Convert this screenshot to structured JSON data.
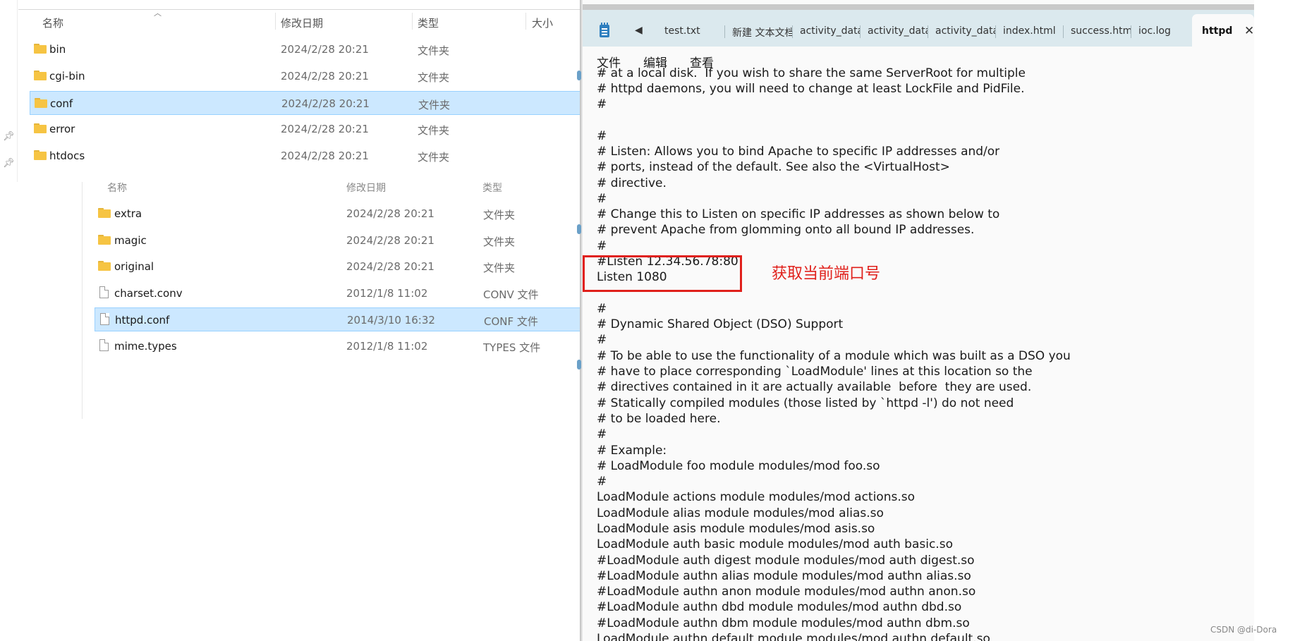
{
  "explorer_top": {
    "columns": {
      "name": "名称",
      "modified": "修改日期",
      "type": "类型",
      "size": "大小"
    },
    "rows": [
      {
        "name": "bin",
        "modified": "2024/2/28 20:21",
        "type": "文件夹",
        "icon": "folder-icon"
      },
      {
        "name": "cgi-bin",
        "modified": "2024/2/28 20:21",
        "type": "文件夹",
        "icon": "folder-icon"
      },
      {
        "name": "conf",
        "modified": "2024/2/28 20:21",
        "type": "文件夹",
        "icon": "folder-icon",
        "selected": true
      },
      {
        "name": "error",
        "modified": "2024/2/28 20:21",
        "type": "文件夹",
        "icon": "folder-icon"
      },
      {
        "name": "htdocs",
        "modified": "2024/2/28 20:21",
        "type": "文件夹",
        "icon": "folder-icon"
      }
    ]
  },
  "explorer_bottom": {
    "columns": {
      "name": "名称",
      "modified": "修改日期",
      "type": "类型"
    },
    "rows": [
      {
        "name": "extra",
        "modified": "2024/2/28 20:21",
        "type": "文件夹",
        "icon": "folder-icon"
      },
      {
        "name": "magic",
        "modified": "2024/2/28 20:21",
        "type": "文件夹",
        "icon": "folder-icon"
      },
      {
        "name": "original",
        "modified": "2024/2/28 20:21",
        "type": "文件夹",
        "icon": "folder-icon"
      },
      {
        "name": "charset.conv",
        "modified": "2012/1/8 11:02",
        "type": "CONV 文件",
        "icon": "file-icon"
      },
      {
        "name": "httpd.conf",
        "modified": "2014/3/10 16:32",
        "type": "CONF 文件",
        "icon": "file-icon",
        "selected": true
      },
      {
        "name": "mime.types",
        "modified": "2012/1/8 11:02",
        "type": "TYPES 文件",
        "icon": "file-icon"
      }
    ]
  },
  "notepad": {
    "tabs": [
      "test.txt",
      "新建 文本文档",
      "activity_data",
      "activity_data",
      "activity_data",
      "index.html",
      "success.htm",
      "ioc.log",
      "httpd"
    ],
    "active_tab": "httpd",
    "close_glyph": "✕",
    "back_glyph": "◀",
    "menu": {
      "file": "文件",
      "edit": "编辑",
      "view": "查看"
    },
    "lines": [
      "# at a local disk.  If you wish to share the same ServerRoot for multiple",
      "# httpd daemons, you will need to change at least LockFile and PidFile.",
      "#",
      "",
      "#",
      "# Listen: Allows you to bind Apache to specific IP addresses and/or",
      "# ports, instead of the default. See also the <VirtualHost>",
      "# directive.",
      "#",
      "# Change this to Listen on specific IP addresses as shown below to",
      "# prevent Apache from glomming onto all bound IP addresses.",
      "#",
      "#Listen 12.34.56.78:80",
      "Listen 1080",
      "",
      "#",
      "# Dynamic Shared Object (DSO) Support",
      "#",
      "# To be able to use the functionality of a module which was built as a DSO you",
      "# have to place corresponding `LoadModule' lines at this location so the",
      "# directives contained in it are actually available  before  they are used.",
      "# Statically compiled modules (those listed by `httpd -l') do not need",
      "# to be loaded here.",
      "#",
      "# Example:",
      "# LoadModule foo module modules/mod foo.so",
      "#",
      "LoadModule actions module modules/mod actions.so",
      "LoadModule alias module modules/mod alias.so",
      "LoadModule asis module modules/mod asis.so",
      "LoadModule auth basic module modules/mod auth basic.so",
      "#LoadModule auth digest module modules/mod auth digest.so",
      "#LoadModule authn alias module modules/mod authn alias.so",
      "#LoadModule authn anon module modules/mod authn anon.so",
      "#LoadModule authn dbd module modules/mod authn dbd.so",
      "#LoadModule authn dbm module modules/mod authn dbm.so",
      "LoadModule authn default module modules/mod authn default.so"
    ]
  },
  "annotation": {
    "text": "获取当前端口号",
    "color": "#e0201b"
  },
  "watermark": "CSDN @di-Dora",
  "colors": {
    "selection": "#cce8ff",
    "tabbar": "#dbe9ee",
    "folder": "#f6c443"
  }
}
